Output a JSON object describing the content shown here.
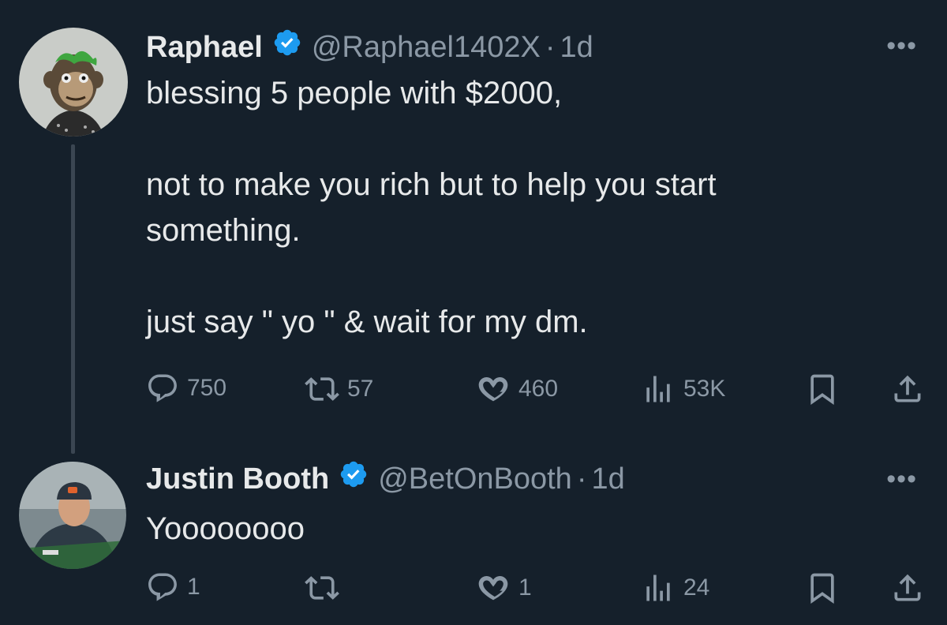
{
  "tweets": [
    {
      "name": "Raphael",
      "handle": "@Raphael1402X",
      "time": "1d",
      "text": [
        "blessing 5 people with $2000,",
        "",
        "not to make you rich but to help you start",
        "something.",
        "",
        "just say \" yo \" & wait for my dm."
      ],
      "replies": "750",
      "retweets": "57",
      "likes": "460",
      "views": "53K"
    },
    {
      "name": "Justin Booth",
      "handle": "@BetOnBooth",
      "time": "1d",
      "text": [
        "Yoooooooo"
      ],
      "replies": "1",
      "retweets": "",
      "likes": "1",
      "views": "24"
    }
  ],
  "colors": {
    "background": "#15202b",
    "text": "#e7e9ea",
    "muted": "#8b98a5",
    "verified": "#1d9bf0",
    "thread_line": "#3b4652"
  },
  "icons": {
    "reply": "speech-bubble-icon",
    "retweet": "retweet-arrows-icon",
    "like": "heart-icon",
    "views": "bar-chart-icon",
    "bookmark": "bookmark-icon",
    "share": "share-upload-icon",
    "more": "ellipsis-icon",
    "verified": "verified-badge-icon"
  }
}
